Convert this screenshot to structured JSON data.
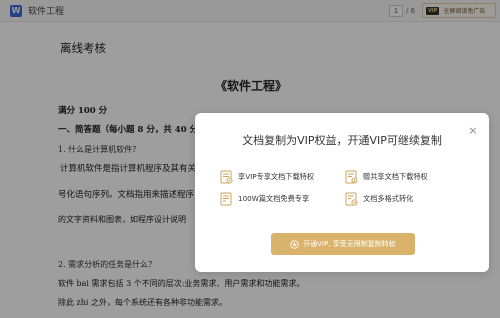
{
  "topbar": {
    "doc_icon_letter": "W",
    "doc_title": "软件工程",
    "page_current": "1",
    "page_total": "/ 6",
    "vip_badge": "VIP",
    "vip_label": "全屏阅读免广告"
  },
  "document": {
    "exam_title": "离线考核",
    "course_title": "《软件工程》",
    "score": "满分 100 分",
    "section": "一、简答题（每小题 8 分，共 40 分",
    "q1": "1. 什么是计算机软件？",
    "a1": "计算机软件是指计算机程序及其有关",
    "a1b": "号化语句序列。文档指用来描述程序",
    "a1c": "的文字资料和图表，如程序设计说明",
    "q2": "2. 需求分析的任务是什么？",
    "a2": "软件 bai 需求包括 3 个不同的层次:业务需求、用户需求和功能需求。",
    "a2b": "除此 zhi 之外，每个系统还有各种非功能需求。"
  },
  "modal": {
    "title": "文档复制为VIP权益，开通VIP可继续复制",
    "close": "×",
    "features": [
      {
        "icon": "vip-download-icon",
        "label": "享VIP专享文档下载特权"
      },
      {
        "icon": "shared-download-icon",
        "label": "赠共享文档下载特权"
      },
      {
        "icon": "free-docs-icon",
        "label": "100W篇文档免费专享"
      },
      {
        "icon": "multi-format-icon",
        "label": "文档多格式转化"
      }
    ],
    "cta_label": "开通VIP, 享受无限制复制特权",
    "accent_color": "#d9b26c"
  }
}
